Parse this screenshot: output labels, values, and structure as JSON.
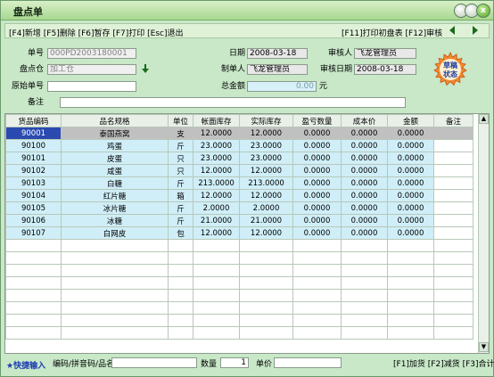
{
  "window": {
    "title": "盘点单"
  },
  "toolbar": {
    "left_text": "[F4]新增 [F5]删除 [F6]暂存 [F7]打印 [Esc]退出",
    "right_text": "[F11]打印初盘表 [F12]审核",
    "prev_icon": "◆",
    "next_icon": "◆"
  },
  "form": {
    "order_no_label": "单号",
    "order_no_value": "000PD2003180001",
    "date_label": "日期",
    "date_value": "2008-03-18",
    "reviewer_label": "审核人",
    "reviewer_value": "飞龙管理员",
    "warehouse_label": "盘点仓",
    "warehouse_value": "加工仓",
    "maker_label": "制单人",
    "maker_value": "飞龙管理员",
    "review_date_label": "审核日期",
    "review_date_value": "2008-03-18",
    "orig_no_label": "原始单号",
    "orig_no_value": "",
    "total_label": "总金额",
    "total_value": "0.00",
    "total_unit": "元",
    "remark_label": "备注",
    "remark_value": "",
    "stamp_line1": "草稿",
    "stamp_line2": "状态"
  },
  "grid": {
    "columns": [
      "货品编码",
      "品名规格",
      "单位",
      "帐面库存",
      "实际库存",
      "盈亏数量",
      "成本价",
      "金额",
      "备注"
    ],
    "rows": [
      [
        "90001",
        "泰国燕窝",
        "支",
        "12.0000",
        "12.0000",
        "0.0000",
        "0.0000",
        "0.0000",
        ""
      ],
      [
        "90100",
        "鸡蛋",
        "斤",
        "23.0000",
        "23.0000",
        "0.0000",
        "0.0000",
        "0.0000",
        ""
      ],
      [
        "90101",
        "皮蛋",
        "只",
        "23.0000",
        "23.0000",
        "0.0000",
        "0.0000",
        "0.0000",
        ""
      ],
      [
        "90102",
        "咸蛋",
        "只",
        "12.0000",
        "12.0000",
        "0.0000",
        "0.0000",
        "0.0000",
        ""
      ],
      [
        "90103",
        "白糖",
        "斤",
        "213.0000",
        "213.0000",
        "0.0000",
        "0.0000",
        "0.0000",
        ""
      ],
      [
        "90104",
        "红片糖",
        "箱",
        "12.0000",
        "12.0000",
        "0.0000",
        "0.0000",
        "0.0000",
        ""
      ],
      [
        "90105",
        "冰片糖",
        "斤",
        "2.0000",
        "2.0000",
        "0.0000",
        "0.0000",
        "0.0000",
        ""
      ],
      [
        "90106",
        "冰糖",
        "斤",
        "21.0000",
        "21.0000",
        "0.0000",
        "0.0000",
        "0.0000",
        ""
      ],
      [
        "90107",
        "白网皮",
        "包",
        "12.0000",
        "12.0000",
        "0.0000",
        "0.0000",
        "0.0000",
        ""
      ]
    ]
  },
  "status": {
    "quick_label": "★快捷输入",
    "code_label": "编码/拼音码/品名",
    "code_value": "",
    "qty_label": "数量",
    "qty_value": "1",
    "price_label": "单价",
    "price_value": "",
    "hint": "[F1]加货 [F2]减货 [F3]合计"
  }
}
